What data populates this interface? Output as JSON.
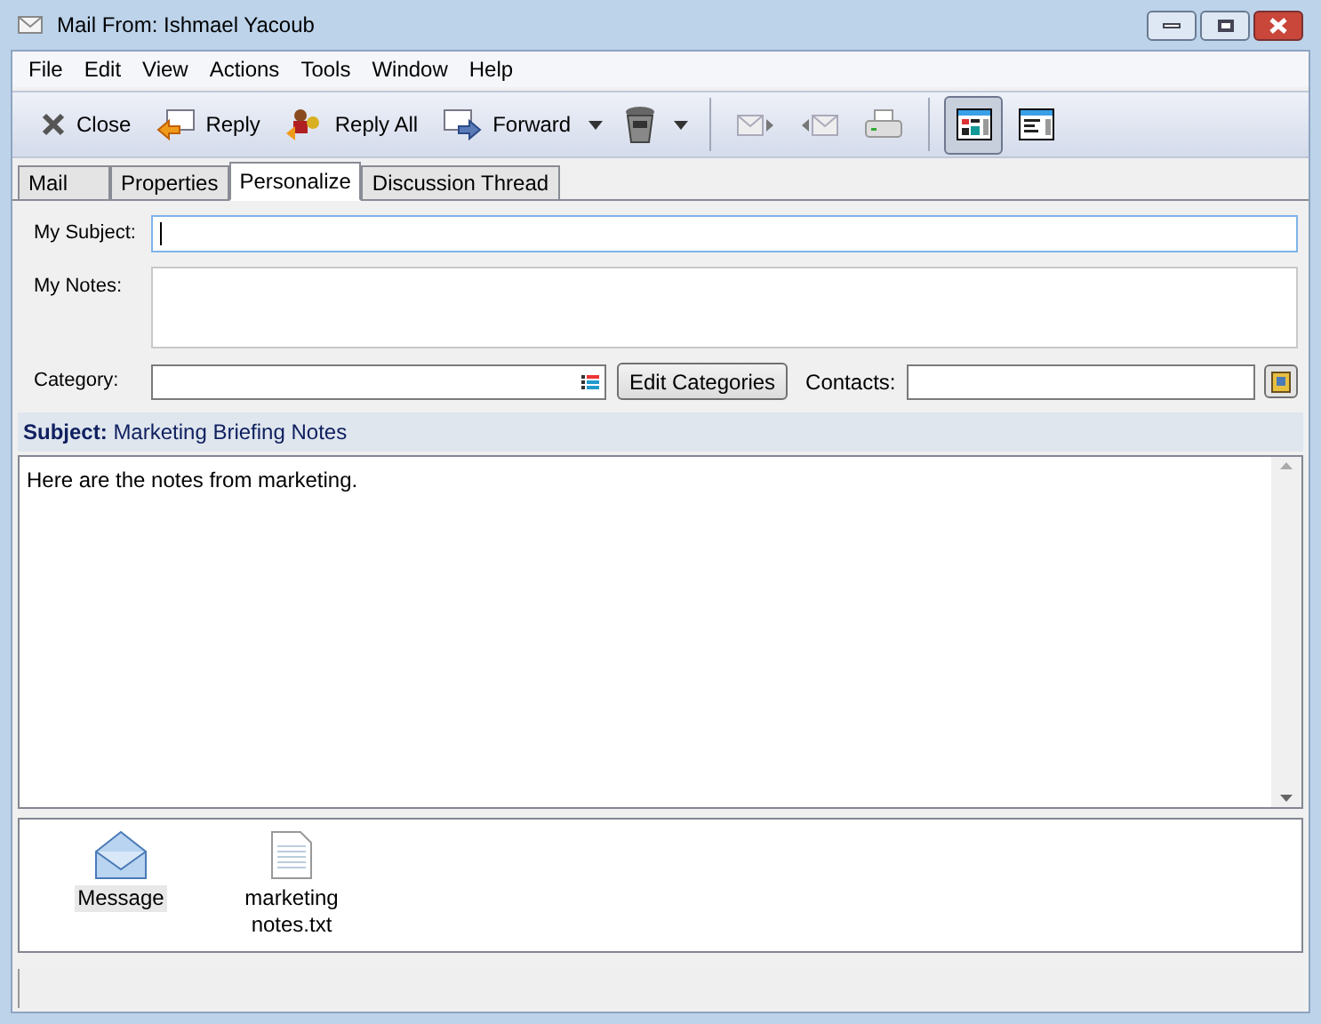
{
  "window": {
    "title": "Mail From: Ishmael Yacoub"
  },
  "menu": [
    "File",
    "Edit",
    "View",
    "Actions",
    "Tools",
    "Window",
    "Help"
  ],
  "toolbar": [
    {
      "kind": "labeled",
      "label": "Close",
      "dropdown": false
    },
    {
      "kind": "labeled",
      "label": "Reply",
      "dropdown": false
    },
    {
      "kind": "labeled",
      "label": "Reply All",
      "dropdown": false
    },
    {
      "kind": "labeled",
      "label": "Forward",
      "dropdown": true
    },
    {
      "kind": "icon",
      "dropdown": true
    },
    {
      "kind": "separator"
    },
    {
      "kind": "icon",
      "dropdown": false
    },
    {
      "kind": "icon",
      "dropdown": false
    },
    {
      "kind": "icon",
      "dropdown": false
    },
    {
      "kind": "separator"
    },
    {
      "kind": "toggle",
      "selected": true
    },
    {
      "kind": "toggle",
      "selected": false
    }
  ],
  "tabs": [
    {
      "label": "Mail",
      "selected": false
    },
    {
      "label": "Properties",
      "selected": false
    },
    {
      "label": "Personalize",
      "selected": true
    },
    {
      "label": "Discussion Thread",
      "selected": false
    }
  ],
  "form": {
    "subject_label": "My Subject:",
    "notes_label": "My Notes:",
    "category_label": "Category:",
    "edit_categories": "Edit Categories",
    "contacts_label": "Contacts:"
  },
  "subject": {
    "label": "Subject:",
    "value": "Marketing Briefing Notes"
  },
  "body": "Here are the notes from marketing.",
  "attachments": [
    {
      "kind": "message",
      "name": "Message",
      "selected": true
    },
    {
      "kind": "text",
      "name": "marketing notes.txt",
      "selected": false
    }
  ]
}
